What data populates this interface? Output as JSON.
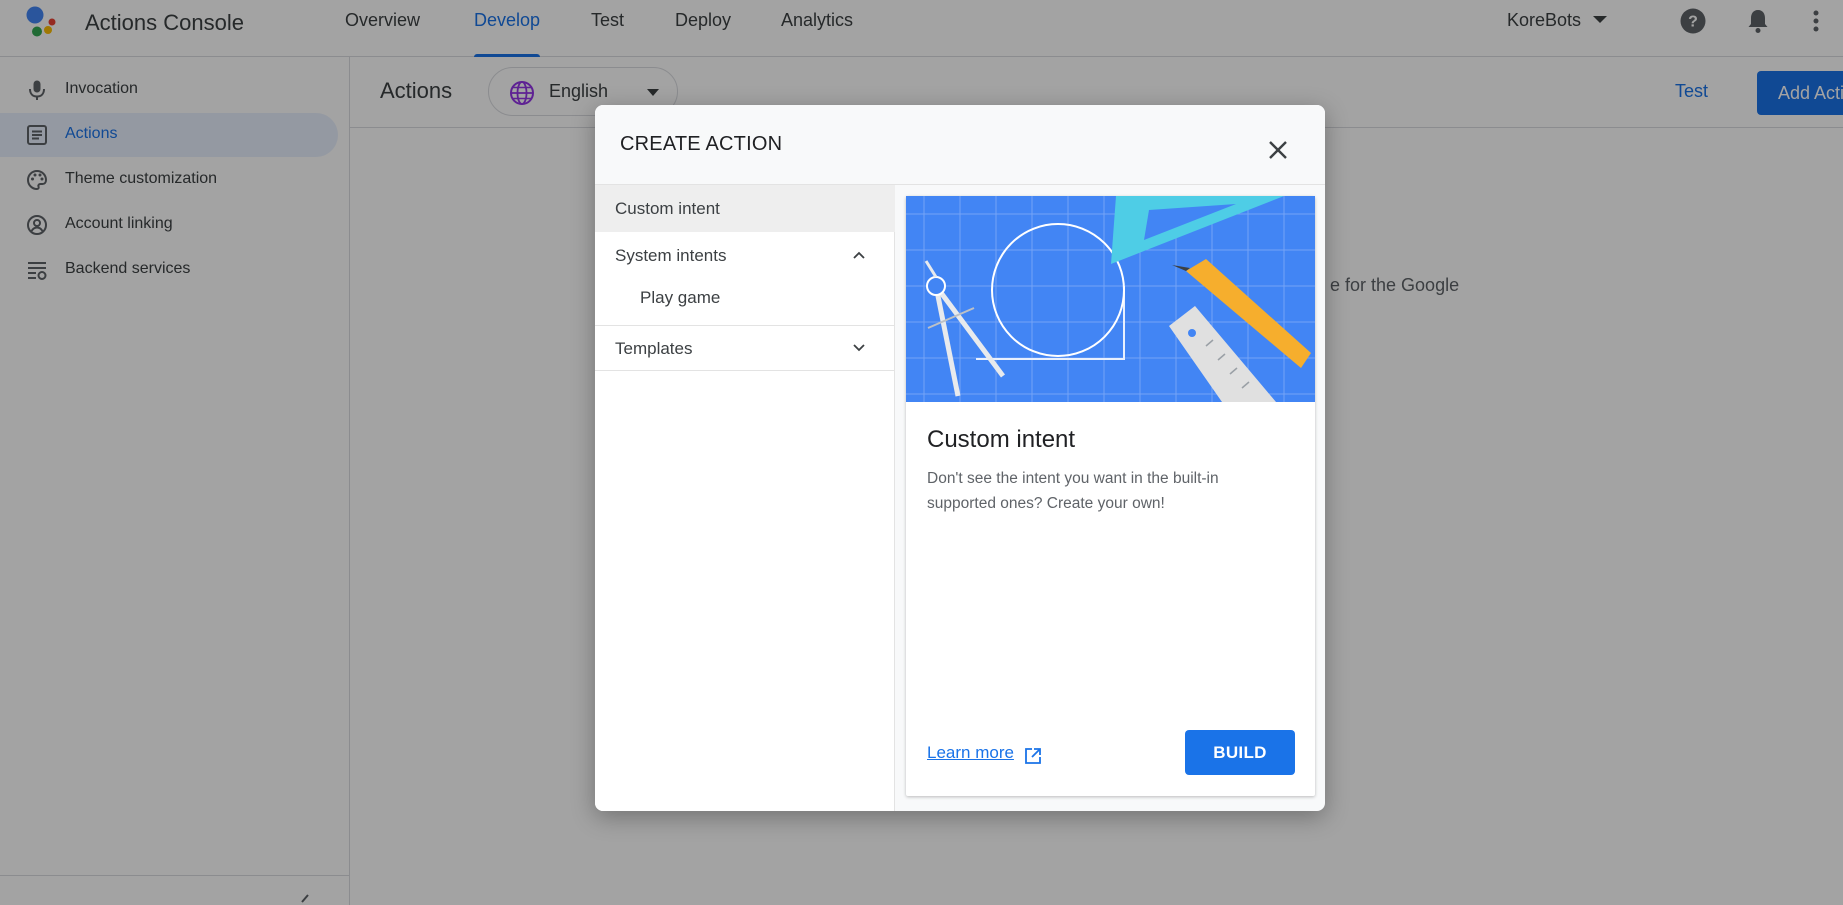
{
  "app": {
    "title": "Actions Console",
    "logo_icon": "google-assistant-logo"
  },
  "topnav": {
    "tabs": [
      {
        "label": "Overview"
      },
      {
        "label": "Develop",
        "active": true
      },
      {
        "label": "Test"
      },
      {
        "label": "Deploy"
      },
      {
        "label": "Analytics"
      }
    ],
    "account": "KoreBots",
    "icons": [
      "help-icon",
      "notifications-icon",
      "more-vert-icon"
    ]
  },
  "sidebar": {
    "items": [
      {
        "label": "Invocation",
        "icon": "mic-icon"
      },
      {
        "label": "Actions",
        "icon": "list-icon",
        "active": true
      },
      {
        "label": "Theme customization",
        "icon": "palette-icon"
      },
      {
        "label": "Account linking",
        "icon": "account-circle-icon"
      },
      {
        "label": "Backend services",
        "icon": "settings-list-icon"
      }
    ]
  },
  "main": {
    "title": "Actions",
    "language": "English",
    "test_label": "Test",
    "add_action_label": "Add Action",
    "background_text": "e for the Google"
  },
  "dialog": {
    "title": "CREATE ACTION",
    "menu": {
      "custom_intent": "Custom intent",
      "system_intents": "System intents",
      "play_game": "Play game",
      "templates": "Templates"
    },
    "card": {
      "title": "Custom intent",
      "description": "Don't see the intent you want in the built-in supported ones? Create your own!",
      "learn_more": "Learn more",
      "build": "BUILD"
    }
  },
  "colors": {
    "accent": "#1a73e8",
    "illustration_bg": "#4285f4"
  }
}
